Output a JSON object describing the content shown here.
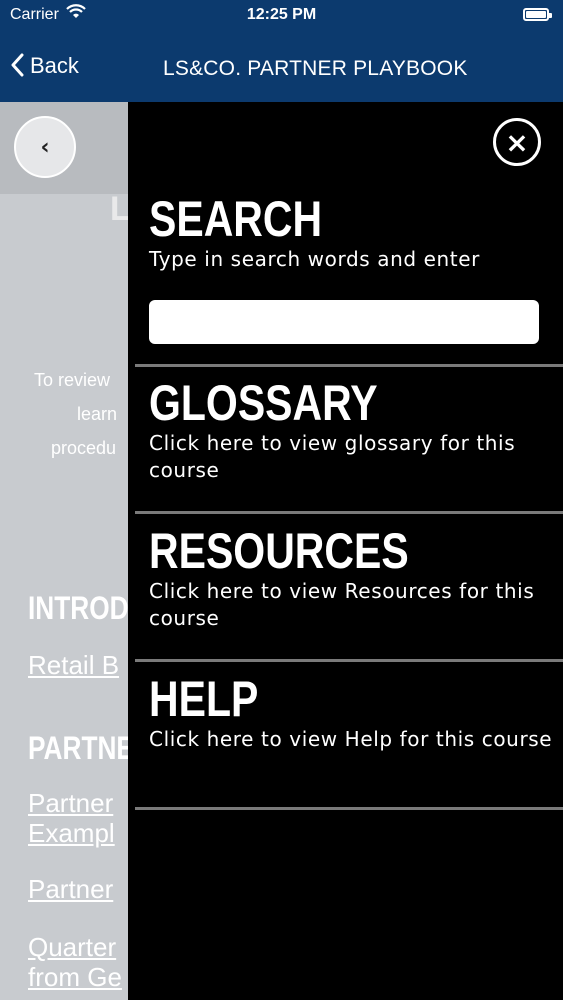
{
  "status_bar": {
    "carrier": "Carrier",
    "time": "12:25 PM",
    "battery_level": 1.0
  },
  "nav": {
    "back_label": "Back",
    "title": "LS&CO. PARTNER PLAYBOOK"
  },
  "background": {
    "back_circle_glyph": "‹",
    "title_fragment": "L",
    "intro_lines": [
      "To review",
      "learn",
      "procedu"
    ],
    "headings": [
      "INTRODU",
      "PARTNE"
    ],
    "links": [
      "Retail B",
      "Partner",
      "Exampl",
      "Partner",
      "Quarter",
      "from Ge"
    ]
  },
  "menu": {
    "close_glyph": "×",
    "sections": [
      {
        "title": "SEARCH",
        "desc": "Type in search words and enter"
      },
      {
        "title": "GLOSSARY",
        "desc": "Click here to view glossary for this course"
      },
      {
        "title": "RESOURCES",
        "desc": "Click here to view Resources for this course"
      },
      {
        "title": "HELP",
        "desc": "Click here to view Help for this course"
      }
    ],
    "search": {
      "value": "",
      "placeholder": ""
    }
  }
}
